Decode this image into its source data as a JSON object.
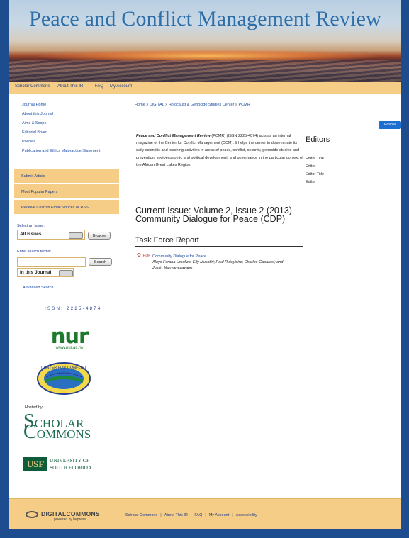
{
  "header": {
    "title": "Peace and Conflict Management Review"
  },
  "topnav": [
    "Scholar Commons",
    "About This IR",
    "FAQ",
    "My Account"
  ],
  "sidebar": {
    "links": [
      "Journal Home",
      "About this Journal",
      "Aims & Scope",
      "Editorial Board",
      "Policies",
      "Publication and Ethics Malpractice Statement"
    ],
    "blocks": [
      "Submit Article",
      "Most Popular Papers",
      "Receive Custom Email Notices or RSS"
    ],
    "issue_label": "Select an issue:",
    "issue_select": "All Issues",
    "browse_label": "Browse",
    "search_label": "Enter search terms:",
    "search_value": "",
    "search_button": "Search",
    "scope_select": "in this Journal",
    "advanced": "Advanced Search",
    "issn": "ISSN: 2225-4874",
    "nur_word": "nur",
    "nur_url": "www.nur.ac.rw",
    "ccm_text": "CENTER FOR CONFLICT",
    "hosted_by": "Hosted by:",
    "scholar_line1": "CHOLAR",
    "scholar_line2": "OMMONS",
    "scholar_s": "S",
    "scholar_c": "C",
    "usf_box": "USF",
    "usf_text1": "UNIVERSITY OF",
    "usf_text2": "SOUTH FLORIDA"
  },
  "breadcrumb": {
    "home": "Home",
    "digital": "DIGITAL",
    "center": "Holocaust & Genocide Studies Center",
    "pcmr": "PCMR",
    "sep": "»"
  },
  "follow": "Follow",
  "intro": {
    "journal_name": "Peace and Conflict Management Review",
    "text": " (PCMR) (ISSN 2225-4874) acts as an internal magazine of the Center for Conflict Management (CCM). It helps the center to disseminate its daily scientific and teaching activities in areas of peace, conflict, security, genocide studies and prevention, socioeconomic and political development, and governance in the particular context of the African Great Lakes Region."
  },
  "editors": {
    "heading": "Editors",
    "items": [
      {
        "line1": "Editor Title",
        "line2": "Editor"
      },
      {
        "line1": "Editor Title",
        "line2": "Editor"
      }
    ]
  },
  "issue": {
    "heading": "Current Issue: Volume 2, Issue 2 (2013) Community Dialogue for Peace (CDP)",
    "section": "Task Force Report",
    "pdf_label": "PDF",
    "article_title": "Community Dialogue for Peace",
    "article_authors": "Aloys Furaha Umuliza; Elly Musafiri; Paul Rutayisire; Charles Gasarasi; and Justin Munyanezayabo"
  },
  "footer": {
    "logo_word": "DIGITALCOMMONS",
    "logo_sub": "powered by bepress",
    "links": [
      "Scholar Commons",
      "About This IR",
      "FAQ",
      "My Account",
      "Accessibility"
    ],
    "sep": "|"
  }
}
